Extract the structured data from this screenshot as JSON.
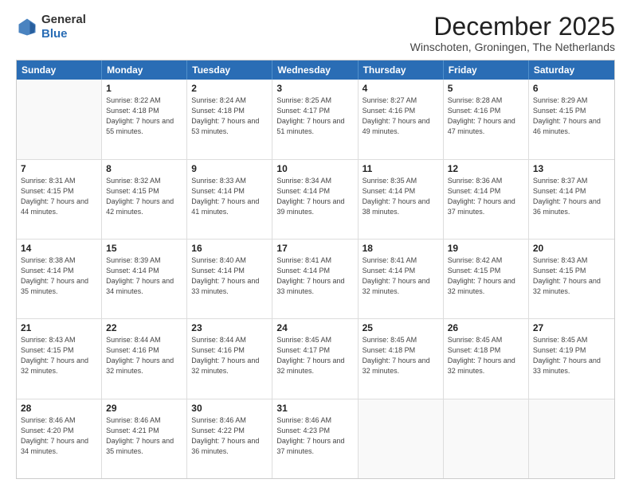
{
  "header": {
    "logo": {
      "line1": "General",
      "line2": "Blue"
    },
    "month": "December 2025",
    "location": "Winschoten, Groningen, The Netherlands"
  },
  "weekdays": [
    "Sunday",
    "Monday",
    "Tuesday",
    "Wednesday",
    "Thursday",
    "Friday",
    "Saturday"
  ],
  "weeks": [
    [
      {
        "day": null
      },
      {
        "day": 1,
        "sunrise": "8:22 AM",
        "sunset": "4:18 PM",
        "daylight": "7 hours and 55 minutes."
      },
      {
        "day": 2,
        "sunrise": "8:24 AM",
        "sunset": "4:18 PM",
        "daylight": "7 hours and 53 minutes."
      },
      {
        "day": 3,
        "sunrise": "8:25 AM",
        "sunset": "4:17 PM",
        "daylight": "7 hours and 51 minutes."
      },
      {
        "day": 4,
        "sunrise": "8:27 AM",
        "sunset": "4:16 PM",
        "daylight": "7 hours and 49 minutes."
      },
      {
        "day": 5,
        "sunrise": "8:28 AM",
        "sunset": "4:16 PM",
        "daylight": "7 hours and 47 minutes."
      },
      {
        "day": 6,
        "sunrise": "8:29 AM",
        "sunset": "4:15 PM",
        "daylight": "7 hours and 46 minutes."
      }
    ],
    [
      {
        "day": 7,
        "sunrise": "8:31 AM",
        "sunset": "4:15 PM",
        "daylight": "7 hours and 44 minutes."
      },
      {
        "day": 8,
        "sunrise": "8:32 AM",
        "sunset": "4:15 PM",
        "daylight": "7 hours and 42 minutes."
      },
      {
        "day": 9,
        "sunrise": "8:33 AM",
        "sunset": "4:14 PM",
        "daylight": "7 hours and 41 minutes."
      },
      {
        "day": 10,
        "sunrise": "8:34 AM",
        "sunset": "4:14 PM",
        "daylight": "7 hours and 39 minutes."
      },
      {
        "day": 11,
        "sunrise": "8:35 AM",
        "sunset": "4:14 PM",
        "daylight": "7 hours and 38 minutes."
      },
      {
        "day": 12,
        "sunrise": "8:36 AM",
        "sunset": "4:14 PM",
        "daylight": "7 hours and 37 minutes."
      },
      {
        "day": 13,
        "sunrise": "8:37 AM",
        "sunset": "4:14 PM",
        "daylight": "7 hours and 36 minutes."
      }
    ],
    [
      {
        "day": 14,
        "sunrise": "8:38 AM",
        "sunset": "4:14 PM",
        "daylight": "7 hours and 35 minutes."
      },
      {
        "day": 15,
        "sunrise": "8:39 AM",
        "sunset": "4:14 PM",
        "daylight": "7 hours and 34 minutes."
      },
      {
        "day": 16,
        "sunrise": "8:40 AM",
        "sunset": "4:14 PM",
        "daylight": "7 hours and 33 minutes."
      },
      {
        "day": 17,
        "sunrise": "8:41 AM",
        "sunset": "4:14 PM",
        "daylight": "7 hours and 33 minutes."
      },
      {
        "day": 18,
        "sunrise": "8:41 AM",
        "sunset": "4:14 PM",
        "daylight": "7 hours and 32 minutes."
      },
      {
        "day": 19,
        "sunrise": "8:42 AM",
        "sunset": "4:15 PM",
        "daylight": "7 hours and 32 minutes."
      },
      {
        "day": 20,
        "sunrise": "8:43 AM",
        "sunset": "4:15 PM",
        "daylight": "7 hours and 32 minutes."
      }
    ],
    [
      {
        "day": 21,
        "sunrise": "8:43 AM",
        "sunset": "4:15 PM",
        "daylight": "7 hours and 32 minutes."
      },
      {
        "day": 22,
        "sunrise": "8:44 AM",
        "sunset": "4:16 PM",
        "daylight": "7 hours and 32 minutes."
      },
      {
        "day": 23,
        "sunrise": "8:44 AM",
        "sunset": "4:16 PM",
        "daylight": "7 hours and 32 minutes."
      },
      {
        "day": 24,
        "sunrise": "8:45 AM",
        "sunset": "4:17 PM",
        "daylight": "7 hours and 32 minutes."
      },
      {
        "day": 25,
        "sunrise": "8:45 AM",
        "sunset": "4:18 PM",
        "daylight": "7 hours and 32 minutes."
      },
      {
        "day": 26,
        "sunrise": "8:45 AM",
        "sunset": "4:18 PM",
        "daylight": "7 hours and 32 minutes."
      },
      {
        "day": 27,
        "sunrise": "8:45 AM",
        "sunset": "4:19 PM",
        "daylight": "7 hours and 33 minutes."
      }
    ],
    [
      {
        "day": 28,
        "sunrise": "8:46 AM",
        "sunset": "4:20 PM",
        "daylight": "7 hours and 34 minutes."
      },
      {
        "day": 29,
        "sunrise": "8:46 AM",
        "sunset": "4:21 PM",
        "daylight": "7 hours and 35 minutes."
      },
      {
        "day": 30,
        "sunrise": "8:46 AM",
        "sunset": "4:22 PM",
        "daylight": "7 hours and 36 minutes."
      },
      {
        "day": 31,
        "sunrise": "8:46 AM",
        "sunset": "4:23 PM",
        "daylight": "7 hours and 37 minutes."
      },
      {
        "day": null
      },
      {
        "day": null
      },
      {
        "day": null
      }
    ]
  ]
}
